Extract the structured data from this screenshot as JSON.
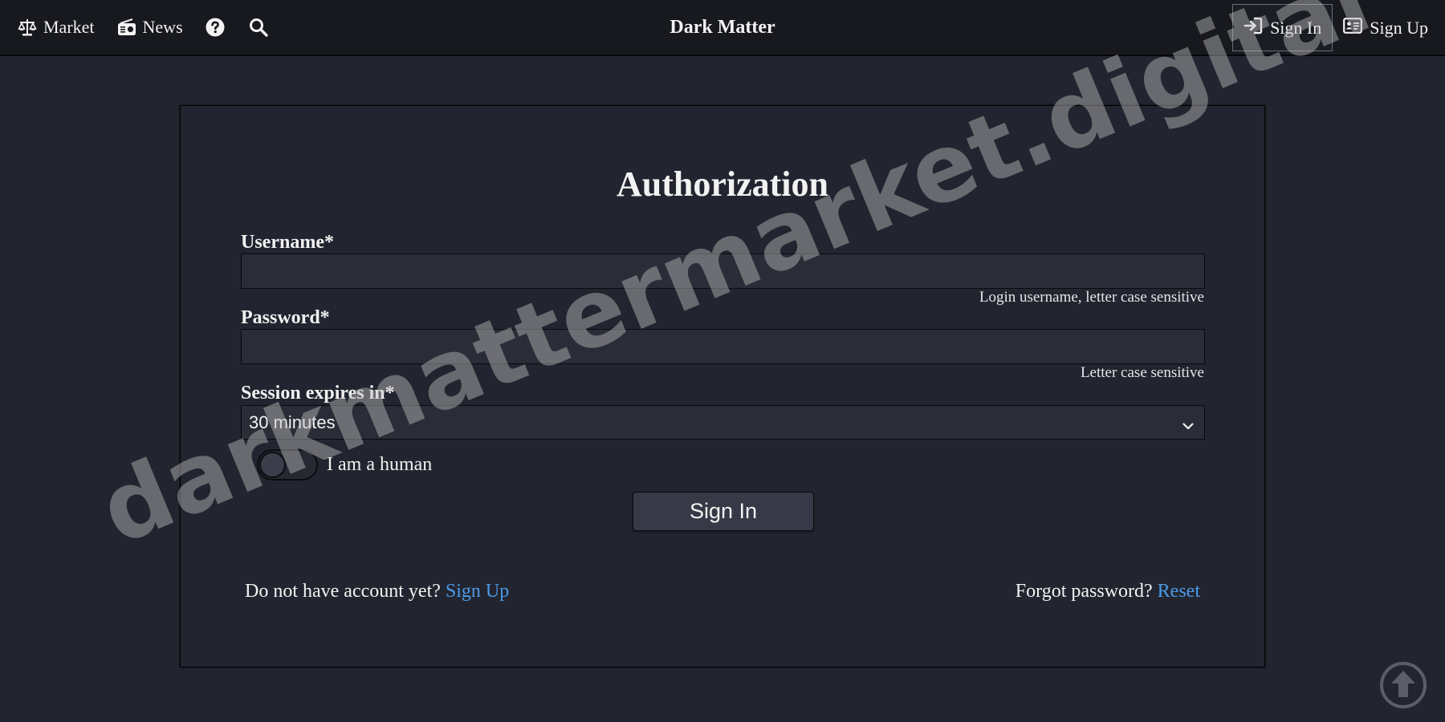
{
  "navbar": {
    "market_label": "Market",
    "news_label": "News",
    "brand": "Dark Matter",
    "sign_in_label": "Sign In",
    "sign_up_label": "Sign Up",
    "icons": [
      "scale-icon",
      "radio-icon",
      "question-circle-icon",
      "search-icon",
      "sign-in-icon",
      "id-card-icon"
    ]
  },
  "form": {
    "title": "Authorization",
    "username_label": "Username*",
    "username_value": "",
    "username_hint": "Login username, letter case sensitive",
    "password_label": "Password*",
    "password_value": "",
    "password_hint": "Letter case sensitive",
    "session_label": "Session expires in*",
    "session_selected": "30 minutes",
    "human_label": "I am a human",
    "human_checked": false,
    "submit_label": "Sign In"
  },
  "footer": {
    "no_account_text": "Do not have account yet?",
    "sign_up_link": "Sign Up",
    "forgot_text": "Forgot password?",
    "reset_link": "Reset"
  },
  "watermark": "darkmattermarket.digital",
  "colors": {
    "background": "#22252f",
    "navbar": "#17191f",
    "link": "#4c9ae8",
    "input": "#2a2d37",
    "button": "#373a46"
  }
}
